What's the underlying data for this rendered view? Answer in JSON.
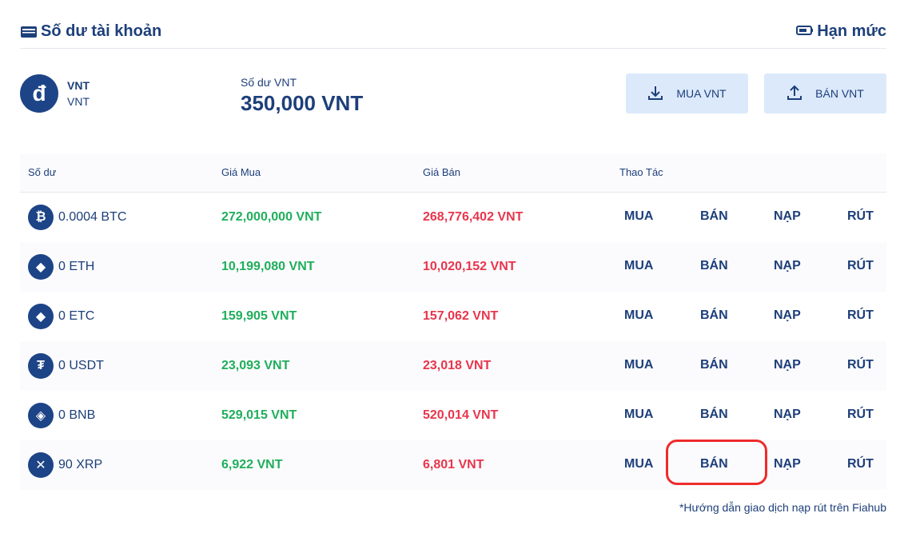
{
  "header": {
    "title": "Số dư tài khoản",
    "limit_label": "Hạn mức",
    "title_icon": "wallet-icon",
    "limit_icon": "battery-icon"
  },
  "vnt": {
    "logo": "đ",
    "name": "VNT",
    "sub": "VNT",
    "balance_label": "Số dư VNT",
    "balance_value": "350,000 VNT",
    "buy_button": "MUA VNT",
    "sell_button": "BÁN VNT"
  },
  "table": {
    "headers": [
      "Số dư",
      "Giá Mua",
      "Giá Bán",
      "Thao Tác"
    ],
    "actions": {
      "buy": "MUA",
      "sell": "BÁN",
      "deposit": "NẠP",
      "withdraw": "RÚT"
    },
    "rows": [
      {
        "icon": "bitcoin-icon",
        "glyph": "₿",
        "balance": "0.0004 BTC",
        "buy_price": "272,000,000 VNT",
        "sell_price": "268,776,402 VNT"
      },
      {
        "icon": "ethereum-icon",
        "glyph": "◆",
        "balance": "0 ETH",
        "buy_price": "10,199,080 VNT",
        "sell_price": "10,020,152 VNT"
      },
      {
        "icon": "ethereum-classic-icon",
        "glyph": "◆",
        "balance": "0 ETC",
        "buy_price": "159,905 VNT",
        "sell_price": "157,062 VNT"
      },
      {
        "icon": "tether-icon",
        "glyph": "₮",
        "balance": "0 USDT",
        "buy_price": "23,093 VNT",
        "sell_price": "23,018 VNT"
      },
      {
        "icon": "bnb-icon",
        "glyph": "◈",
        "balance": "0 BNB",
        "buy_price": "529,015 VNT",
        "sell_price": "520,014 VNT"
      },
      {
        "icon": "xrp-icon",
        "glyph": "✕",
        "balance": "90 XRP",
        "buy_price": "6,922 VNT",
        "sell_price": "6,801 VNT"
      }
    ]
  },
  "footnote": "*Hướng dẫn giao dịch nạp rút trên Fiahub",
  "colors": {
    "primary": "#1d3f7a",
    "buy": "#1fae5b",
    "sell": "#e8354c",
    "button_bg": "#dce9fb",
    "highlight": "#ee2b2b"
  }
}
